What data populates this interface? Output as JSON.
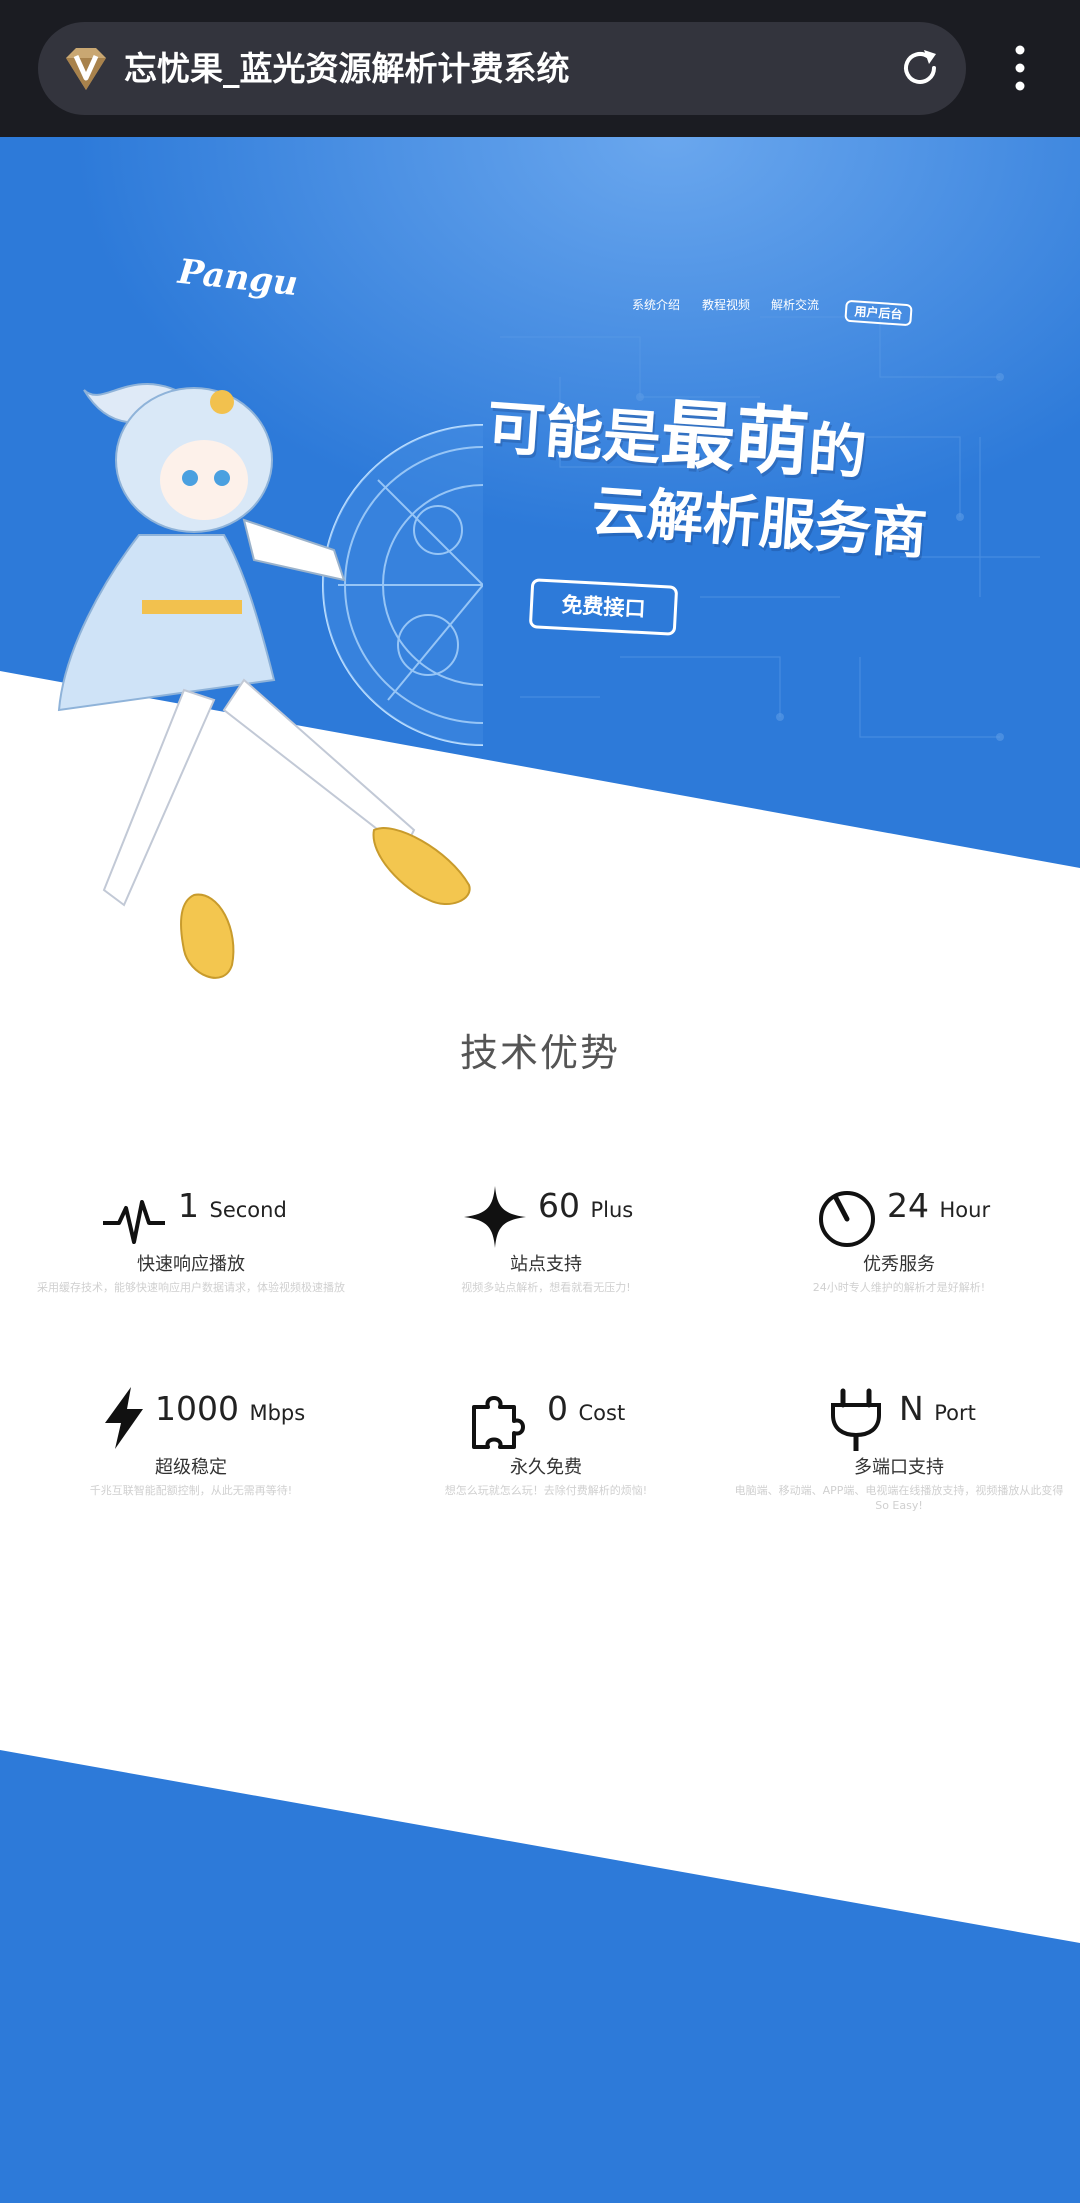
{
  "browser": {
    "title": "忘忧果_蓝光资源解析计费系统",
    "site_icon": "diamond-v-icon",
    "reload_icon": "reload-icon",
    "menu_icon": "vertical-dots-icon"
  },
  "hero": {
    "logo": "Pangu",
    "nav": [
      "系统介绍",
      "教程视频",
      "解析交流"
    ],
    "admin_button": "用户后台",
    "slogan_part1": "可能是",
    "slogan_big": "最萌",
    "slogan_part2": "的",
    "slogan_line2": "云解析服务商",
    "cta_button": "免费接口"
  },
  "colors": {
    "hero_blue": "#2d7ad9",
    "accent_white": "#ffffff"
  },
  "section": {
    "title": "技术优势"
  },
  "features": [
    {
      "icon": "heartbeat-icon",
      "number": "1",
      "unit": "Second",
      "name": "快速响应播放",
      "desc": "采用缓存技术，能够快速响应用户数据请求，体验视频极速播放"
    },
    {
      "icon": "sparkle-star-icon",
      "number": "60",
      "unit": "Plus",
      "name": "站点支持",
      "desc": "视频多站点解析，想看就看无压力!"
    },
    {
      "icon": "timer-icon",
      "number": "24",
      "unit": "Hour",
      "name": "优秀服务",
      "desc": "24小时专人维护的解析才是好解析!"
    },
    {
      "icon": "lightning-icon",
      "number": "1000",
      "unit": "Mbps",
      "name": "超级稳定",
      "desc": "千兆互联智能配额控制，从此无需再等待!"
    },
    {
      "icon": "puzzle-icon",
      "number": "0",
      "unit": "Cost",
      "name": "永久免费",
      "desc": "想怎么玩就怎么玩！去除付费解析的烦恼!"
    },
    {
      "icon": "plug-icon",
      "number": "N",
      "unit": "Port",
      "name": "多端口支持",
      "desc": "电脑端、移动端、APP端、电视端在线播放支持，视频播放从此变得So Easy!"
    }
  ]
}
